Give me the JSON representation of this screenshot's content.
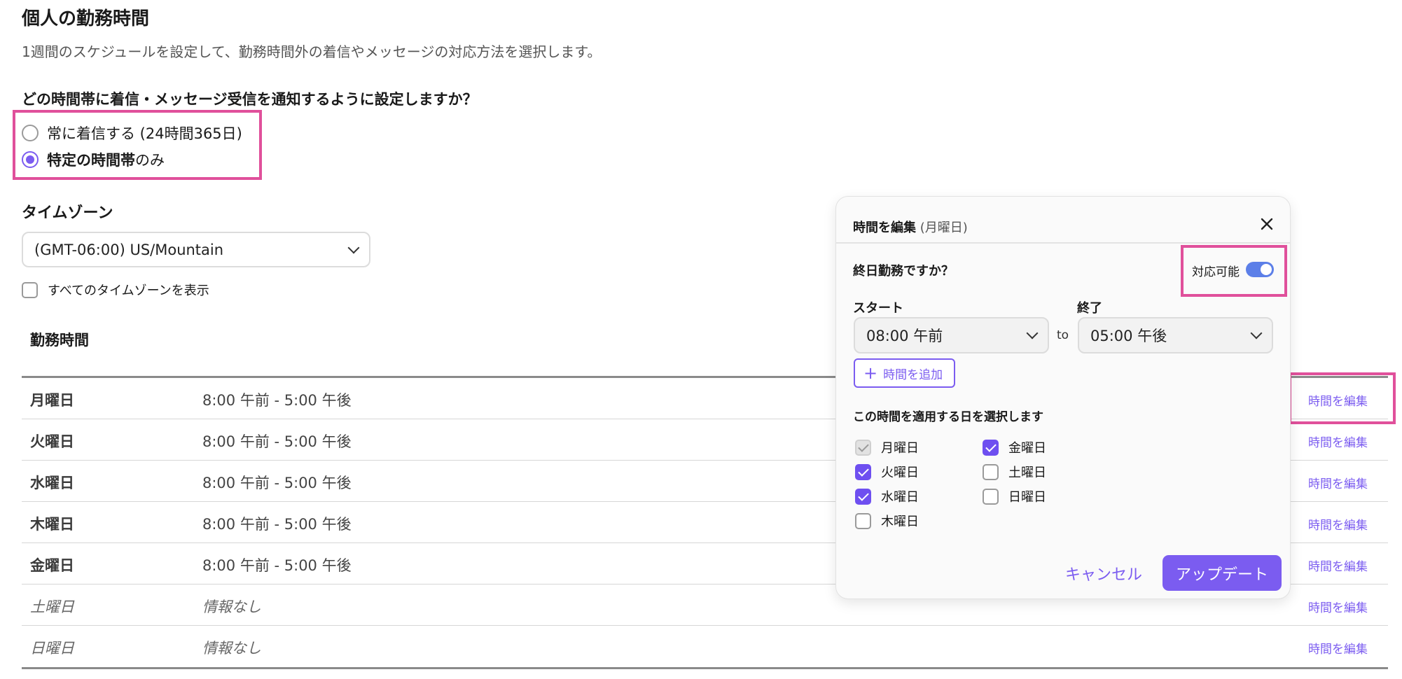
{
  "header": {
    "title": "個人の勤務時間",
    "description": "1週間のスケジュールを設定して、勤務時間外の着信やメッセージの対応方法を選択します。"
  },
  "notification": {
    "question": "どの時間帯に着信・メッセージ受信を通知するように設定しますか？",
    "option_always": "常に着信する (24時間365日)",
    "option_specific_bold": "特定の時間帯",
    "option_specific_suffix": "のみ",
    "selected": "specific"
  },
  "timezone": {
    "label": "タイムゾーン",
    "value": "(GMT-06:00) US/Mountain",
    "show_all_label": "すべてのタイムゾーンを表示",
    "show_all_checked": false
  },
  "working_hours": {
    "label": "勤務時間",
    "edit_label": "時間を編集",
    "rows": [
      {
        "day": "月曜日",
        "hours": "8:00 午前 - 5:00 午後",
        "off": false
      },
      {
        "day": "火曜日",
        "hours": "8:00 午前 - 5:00 午後",
        "off": false
      },
      {
        "day": "水曜日",
        "hours": "8:00 午前 - 5:00 午後",
        "off": false
      },
      {
        "day": "木曜日",
        "hours": "8:00 午前 - 5:00 午後",
        "off": false
      },
      {
        "day": "金曜日",
        "hours": "8:00 午前 - 5:00 午後",
        "off": false
      },
      {
        "day": "土曜日",
        "hours": "情報なし",
        "off": true
      },
      {
        "day": "日曜日",
        "hours": "情報なし",
        "off": true
      }
    ]
  },
  "modal": {
    "title": "時間を編集",
    "title_day": "(月曜日)",
    "all_day_question": "終日勤務ですか？",
    "available_label": "対応可能",
    "available_on": true,
    "start_label": "スタート",
    "end_label": "終了",
    "start_value": "08:00 午前",
    "end_value": "05:00 午後",
    "to_text": "to",
    "add_time_label": "時間を追加",
    "apply_days_label": "この時間を適用する日を選択します",
    "days": [
      {
        "label": "月曜日",
        "state": "disabled"
      },
      {
        "label": "火曜日",
        "state": "checked"
      },
      {
        "label": "水曜日",
        "state": "checked"
      },
      {
        "label": "木曜日",
        "state": "unchecked"
      },
      {
        "label": "金曜日",
        "state": "checked"
      },
      {
        "label": "土曜日",
        "state": "unchecked"
      },
      {
        "label": "日曜日",
        "state": "unchecked"
      }
    ],
    "cancel_label": "キャンセル",
    "update_label": "アップデート"
  },
  "colors": {
    "accent": "#7b5cf0",
    "highlight": "#e0509b",
    "toggle": "#5c7fe8"
  }
}
